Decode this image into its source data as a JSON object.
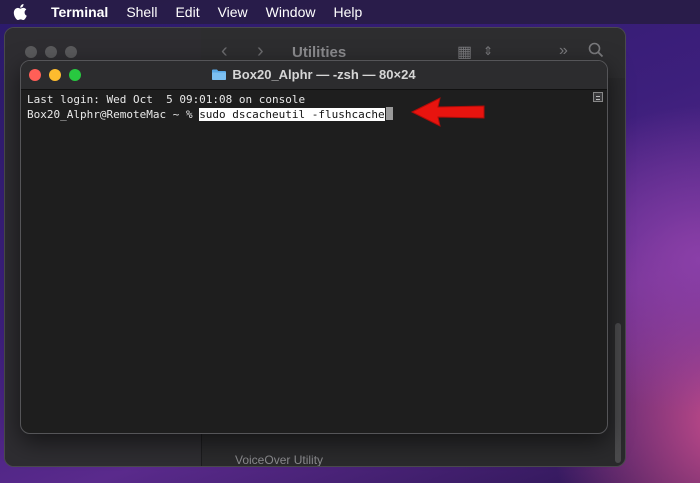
{
  "menubar": {
    "apple_icon": "apple-logo-icon",
    "items": [
      "Terminal",
      "Shell",
      "Edit",
      "View",
      "Window",
      "Help"
    ]
  },
  "finder": {
    "title": "Utilities",
    "bottom_item": "VoiceOver Utility",
    "icons": [
      "back-chevron-icon",
      "forward-chevron-icon",
      "view-grid-icon",
      "more-chevrons-icon",
      "search-icon"
    ]
  },
  "terminal": {
    "title": "Box20_Alphr — -zsh — 80×24",
    "title_icon": "folder-icon",
    "last_login": "Last login: Wed Oct  5 09:01:08 on console",
    "prompt": "Box20_Alphr@RemoteMac ~ % ",
    "command": "sudo dscacheutil -flushcache"
  },
  "annotation": {
    "arrow_color": "#e8140f",
    "icon": "red-arrow-icon"
  },
  "colors": {
    "close": "#ff5f57",
    "minimize": "#febc2e",
    "maximize": "#28c840"
  }
}
